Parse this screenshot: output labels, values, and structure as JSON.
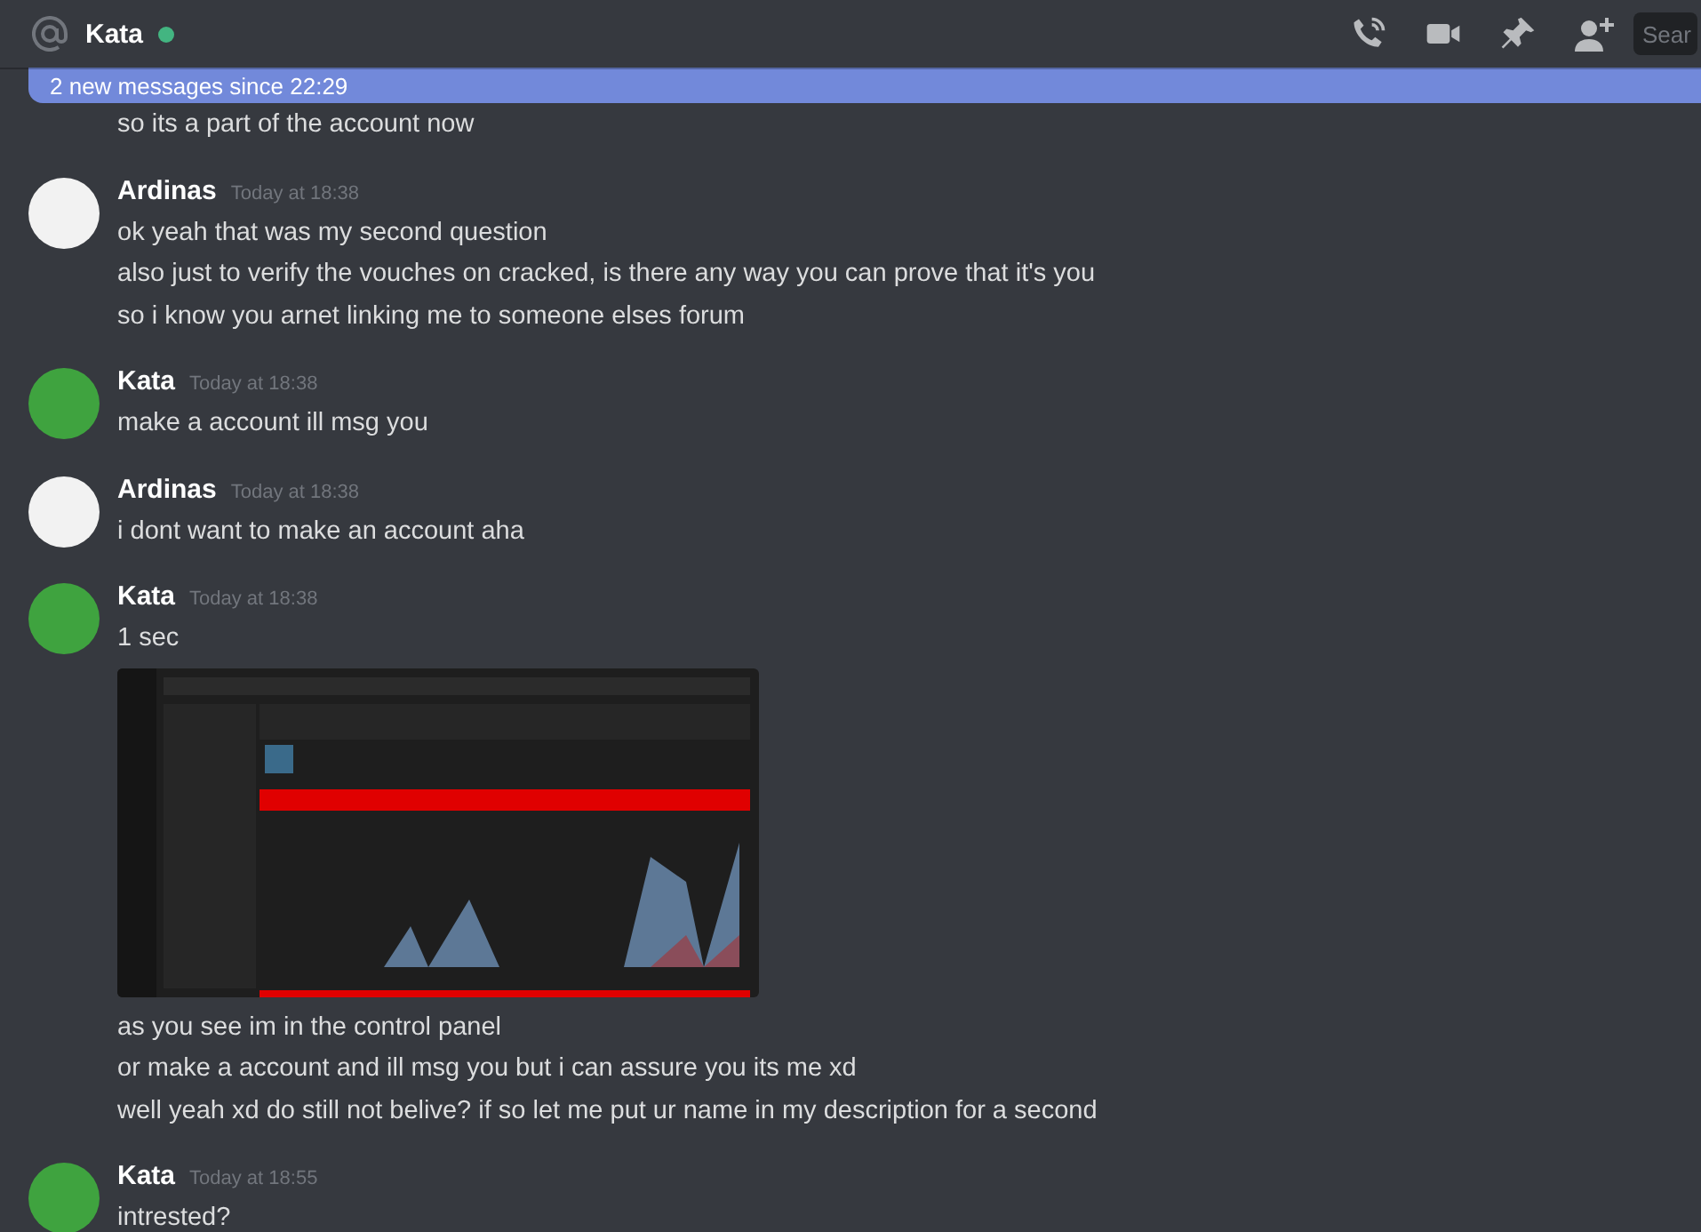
{
  "header": {
    "channel_name": "Kata",
    "online": true,
    "search": {
      "placeholder": "Sear"
    }
  },
  "banner": {
    "text": "2 new messages since 22:29"
  },
  "messages": [
    {
      "kind": "continuation",
      "lines": [
        "so its a part of the account now"
      ]
    },
    {
      "kind": "group",
      "author": "Ardinas",
      "color": "#f2f2f2",
      "time": "Today at 18:38",
      "lines": [
        "ok yeah that was my second question",
        "also just to verify the vouches on cracked, is there any way you can prove that it's you",
        "so i know you arnet linking me to someone elses forum"
      ]
    },
    {
      "kind": "group",
      "author": "Kata",
      "color": "#3fa33f",
      "time": "Today at 18:38",
      "lines": [
        "make a account ill msg you"
      ]
    },
    {
      "kind": "group",
      "author": "Ardinas",
      "color": "#f2f2f2",
      "time": "Today at 18:38",
      "lines": [
        "i dont want to make an account aha"
      ]
    },
    {
      "kind": "group",
      "author": "Kata",
      "color": "#3fa33f",
      "time": "Today at 18:38",
      "lines": [
        "1 sec"
      ],
      "after": [
        "as you see im in the control panel",
        "or make a account and ill msg you but i can assure you its me xd",
        "well yeah xd do still not belive? if so let me put ur name in my description for a second"
      ]
    },
    {
      "kind": "group",
      "author": "Kata",
      "color": "#3fa33f",
      "time": "Today at 18:55",
      "lines": [
        "intrested?"
      ]
    }
  ]
}
